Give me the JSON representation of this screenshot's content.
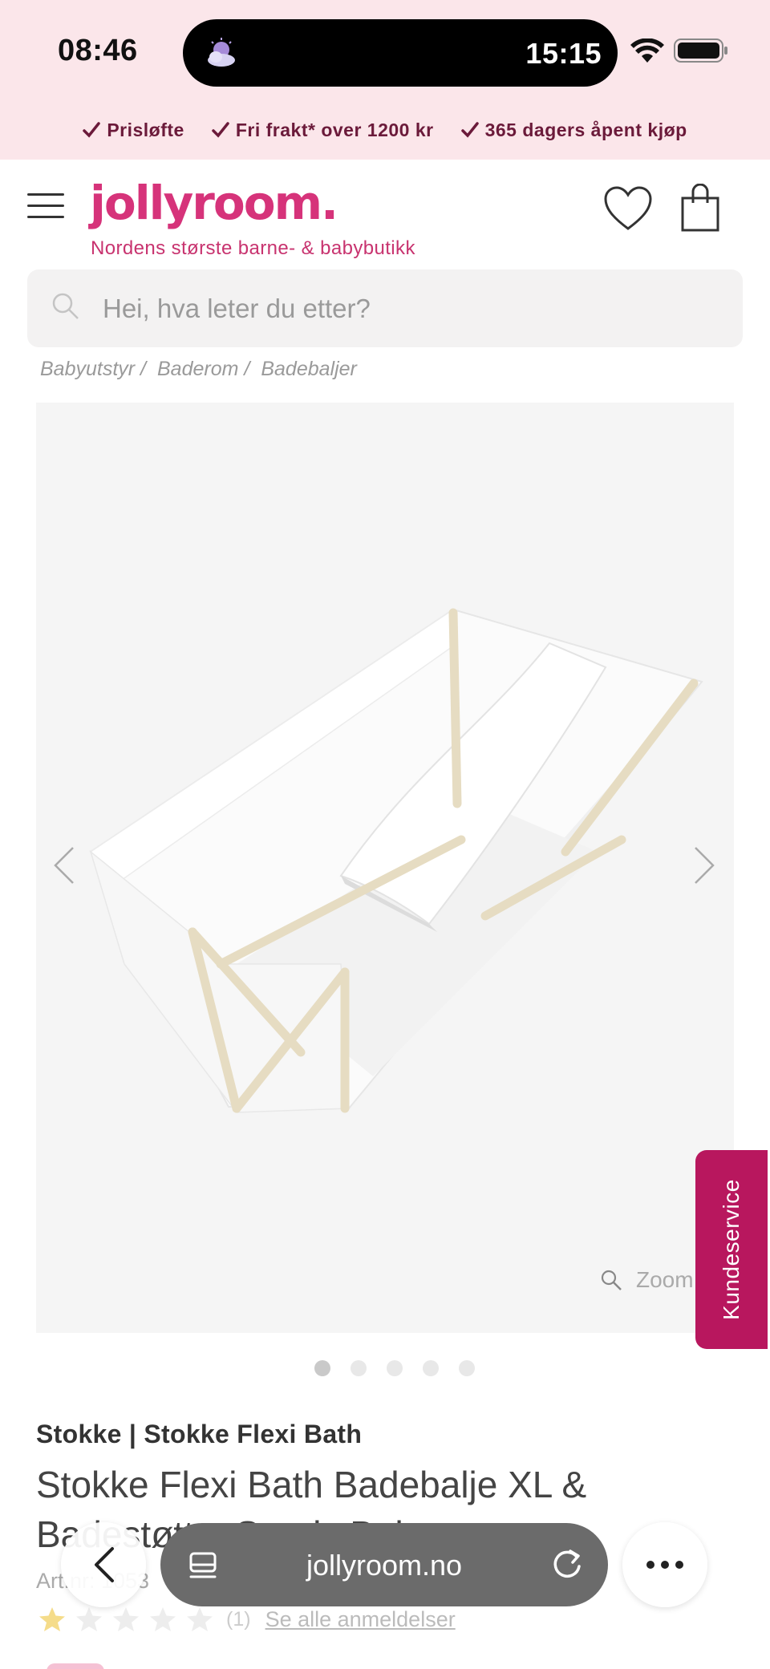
{
  "status_bar": {
    "time": "08:46",
    "island_time": "15:15"
  },
  "promo": {
    "items": [
      "Prisløfte",
      "Fri frakt* over 1200 kr",
      "365 dagers åpent kjøp"
    ]
  },
  "header": {
    "logo": "jollyroom.",
    "tagline": "Nordens største barne- & babybutikk"
  },
  "search": {
    "placeholder": "Hei, hva leter du etter?"
  },
  "breadcrumb": [
    "Babyutstyr /",
    "Baderom /",
    "Badebaljer"
  ],
  "gallery": {
    "zoom_label": "Zoom",
    "image_count": 5,
    "active_index": 0
  },
  "kundeservice_label": "Kundeservice",
  "product": {
    "brand_line": "Stokke | Stokke Flexi Bath",
    "title": "Stokke Flexi Bath Badebalje XL & Badestøtte, Sandy Beige",
    "art_nr": "Art.nr: 1053",
    "rating": 1,
    "rating_max": 5,
    "rating_count": "(1)",
    "see_reviews": "Se alle anmeldelser"
  },
  "browser": {
    "url": "jollyroom.no"
  },
  "colors": {
    "brand_pink": "#d6337a",
    "promo_bg": "#fbe6ea",
    "kundeservice_bg": "#b8175e"
  }
}
